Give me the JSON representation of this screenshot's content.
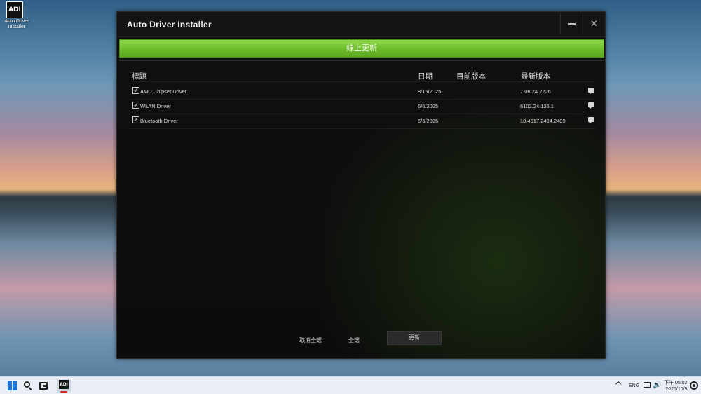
{
  "desktop": {
    "icon_logo": "ADI",
    "icon_label": "Auto Driver Installer"
  },
  "window": {
    "title": "Auto Driver Installer",
    "update_online_button": "線上更新",
    "columns": {
      "title": "標題",
      "date": "日期",
      "current_version": "目前版本",
      "latest_version": "最新版本"
    },
    "drivers": [
      {
        "checked": true,
        "name": "AMD Chipset Driver",
        "date": "8/15/2025",
        "current_version": "",
        "latest_version": "7.06.24.2226"
      },
      {
        "checked": true,
        "name": "WLAN Driver",
        "date": "6/6/2025",
        "current_version": "",
        "latest_version": "6102.24.126.1"
      },
      {
        "checked": true,
        "name": "Bluetooth Driver",
        "date": "6/6/2025",
        "current_version": "",
        "latest_version": "18.4017.2404.2409"
      }
    ],
    "footer": {
      "deselect_all": "取消全選",
      "select_all": "全選",
      "update_button": "更新"
    }
  },
  "taskbar": {
    "lang": "ENG",
    "time_line1": "下午 05:02",
    "time_line2": "2025/10/9",
    "app_logo": "ADI"
  },
  "colors": {
    "accent_green": "#6cbc2a",
    "window_bg": "#0b0c0b"
  }
}
